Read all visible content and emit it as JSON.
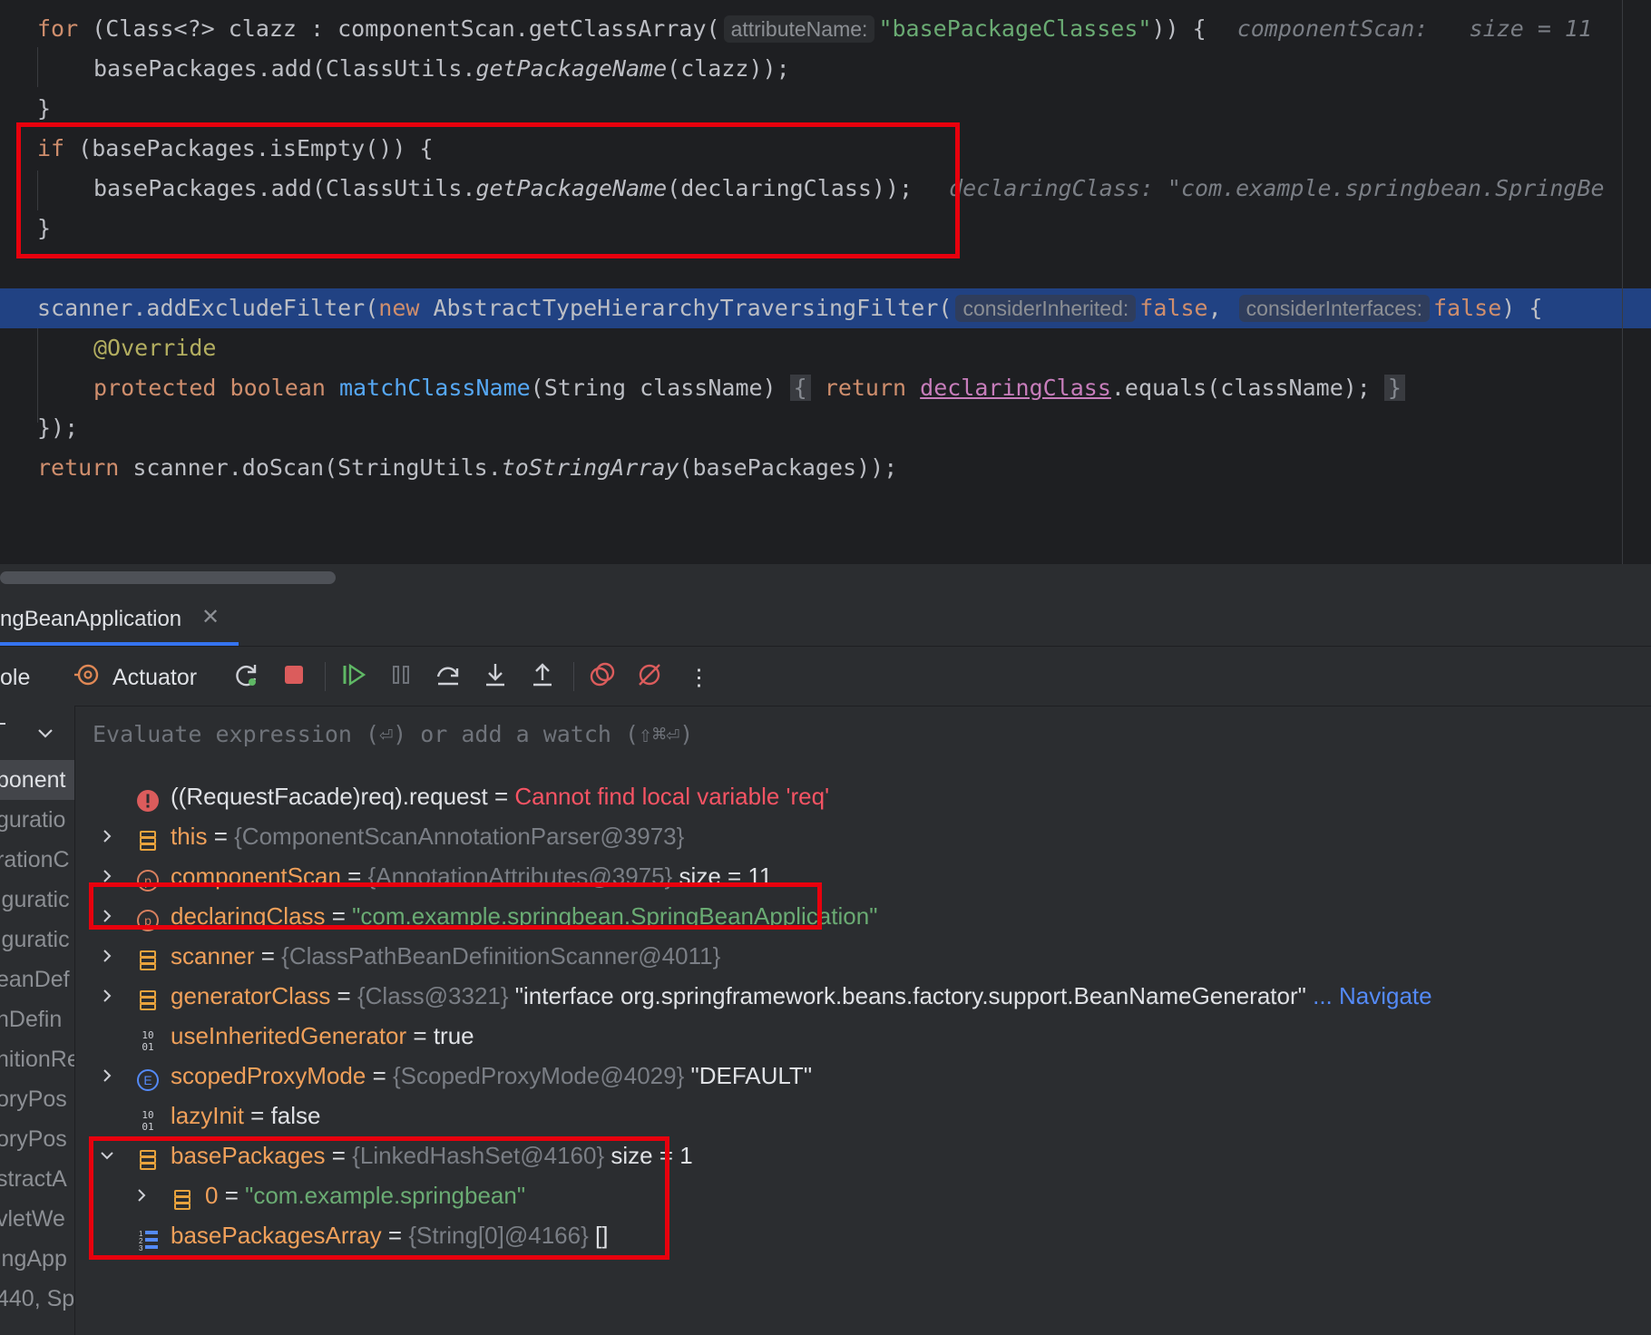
{
  "editor": {
    "line1": {
      "for": "for",
      "a": " (Class<?> clazz : componentScan.getClassArray(",
      "hint": "attributeName:",
      "str": "\"basePackageClasses\"",
      "b": ")) {",
      "inlay": "componentScan:   size = 11"
    },
    "line2": {
      "a": "basePackages.add(ClassUtils.",
      "fn": "getPackageName",
      "b": "(clazz));"
    },
    "line3": "}",
    "line4": {
      "kw": "if",
      "a": " (basePackages.isEmpty()) {"
    },
    "line5": {
      "a": "basePackages.add(ClassUtils.",
      "fn": "getPackageName",
      "b": "(declaringClass));",
      "inlay": "declaringClass: \"com.example.springbean.SpringBe"
    },
    "line6": "}",
    "line7": {
      "a": "scanner.addExcludeFilter(",
      "new": "new",
      "b": " AbstractTypeHierarchyTraversingFilter(",
      "hint1": "considerInherited:",
      "f1": "false",
      "c": ", ",
      "hint2": "considerInterfaces:",
      "f2": "false",
      "d": ") {"
    },
    "line8": "@Override",
    "line9": {
      "kw1": "protected",
      "kw2": "boolean",
      "fn": "matchClassName",
      "a": "(String className) ",
      "fold1": "{",
      "ret": "return",
      "param": "declaringClass",
      "b": ".equals(className);",
      "fold2": "}"
    },
    "line10": "});",
    "line11": {
      "ret": "return",
      "a": " scanner.doScan(StringUtils.",
      "fn": "toStringArray",
      "b": "(basePackages));"
    }
  },
  "debug": {
    "tab_label": "ngBeanApplication",
    "tab_close": "✕",
    "toolbar": {
      "console_label": "ole",
      "actuator_label": "Actuator",
      "more": "⋮"
    },
    "eval_placeholder": "Evaluate expression (⏎) or add a watch (⇧⌘⏎)",
    "frames": [
      "ponent",
      "guratio",
      "rationC",
      "iguratic",
      "iguratic",
      "eanDef",
      "nDefin",
      "nitionRe",
      "oryPos",
      "oryPos",
      "stractA",
      "vletWe",
      "ingApp",
      "440, Sp"
    ],
    "variables": [
      {
        "name": "((RequestFacade)req).request",
        "eq": " = ",
        "value": "Cannot find local variable 'req'",
        "icon": "error-icon"
      },
      {
        "name": "this",
        "eq": " = ",
        "type": "{ComponentScanAnnotationParser@3973}",
        "icon": "object-icon"
      },
      {
        "name": "componentScan",
        "eq": " = ",
        "type": "{AnnotationAttributes@3975}",
        "extra": "  size = 11",
        "icon": "parameter-icon"
      },
      {
        "name": "declaringClass",
        "eq": " = ",
        "str": "\"com.example.springbean.SpringBeanApplication\"",
        "icon": "parameter-icon"
      },
      {
        "name": "scanner",
        "eq": " = ",
        "type": "{ClassPathBeanDefinitionScanner@4011}",
        "icon": "object-icon"
      },
      {
        "name": "generatorClass",
        "eq": " = ",
        "type": "{Class@3321}",
        "extra": " \"interface org.springframework.beans.factory.support.BeanNameGenerator\"",
        "link": " ... Navigate",
        "icon": "object-icon"
      },
      {
        "name": "useInheritedGenerator",
        "eq": " = ",
        "extra": "true",
        "icon": "primitive-icon"
      },
      {
        "name": "scopedProxyMode",
        "eq": " = ",
        "type": "{ScopedProxyMode@4029}",
        "extra": " \"DEFAULT\"",
        "icon": "enum-icon"
      },
      {
        "name": "lazyInit",
        "eq": " = ",
        "extra": "false",
        "icon": "primitive-icon"
      },
      {
        "name": "basePackages",
        "eq": " = ",
        "type": "{LinkedHashSet@4160}",
        "extra": "  size = 1",
        "icon": "object-icon"
      },
      {
        "name": "0",
        "eq": " = ",
        "str": "\"com.example.springbean\"",
        "icon": "object-icon"
      },
      {
        "name": "basePackagesArray",
        "eq": " = ",
        "type": "{String[0]@4166}",
        "extra": " []",
        "icon": "array-icon"
      }
    ]
  },
  "colors": {
    "highlight_box": "#e8000d",
    "selected_line": "#214283",
    "accent": "#3574f0"
  }
}
